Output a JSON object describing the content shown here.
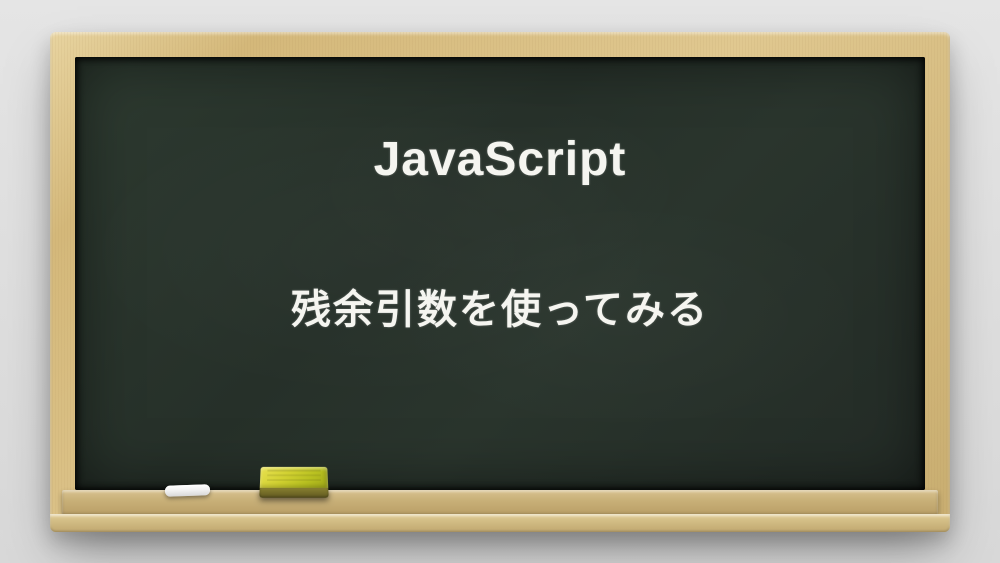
{
  "board": {
    "title": "JavaScript",
    "subtitle": "残余引数を使ってみる"
  }
}
